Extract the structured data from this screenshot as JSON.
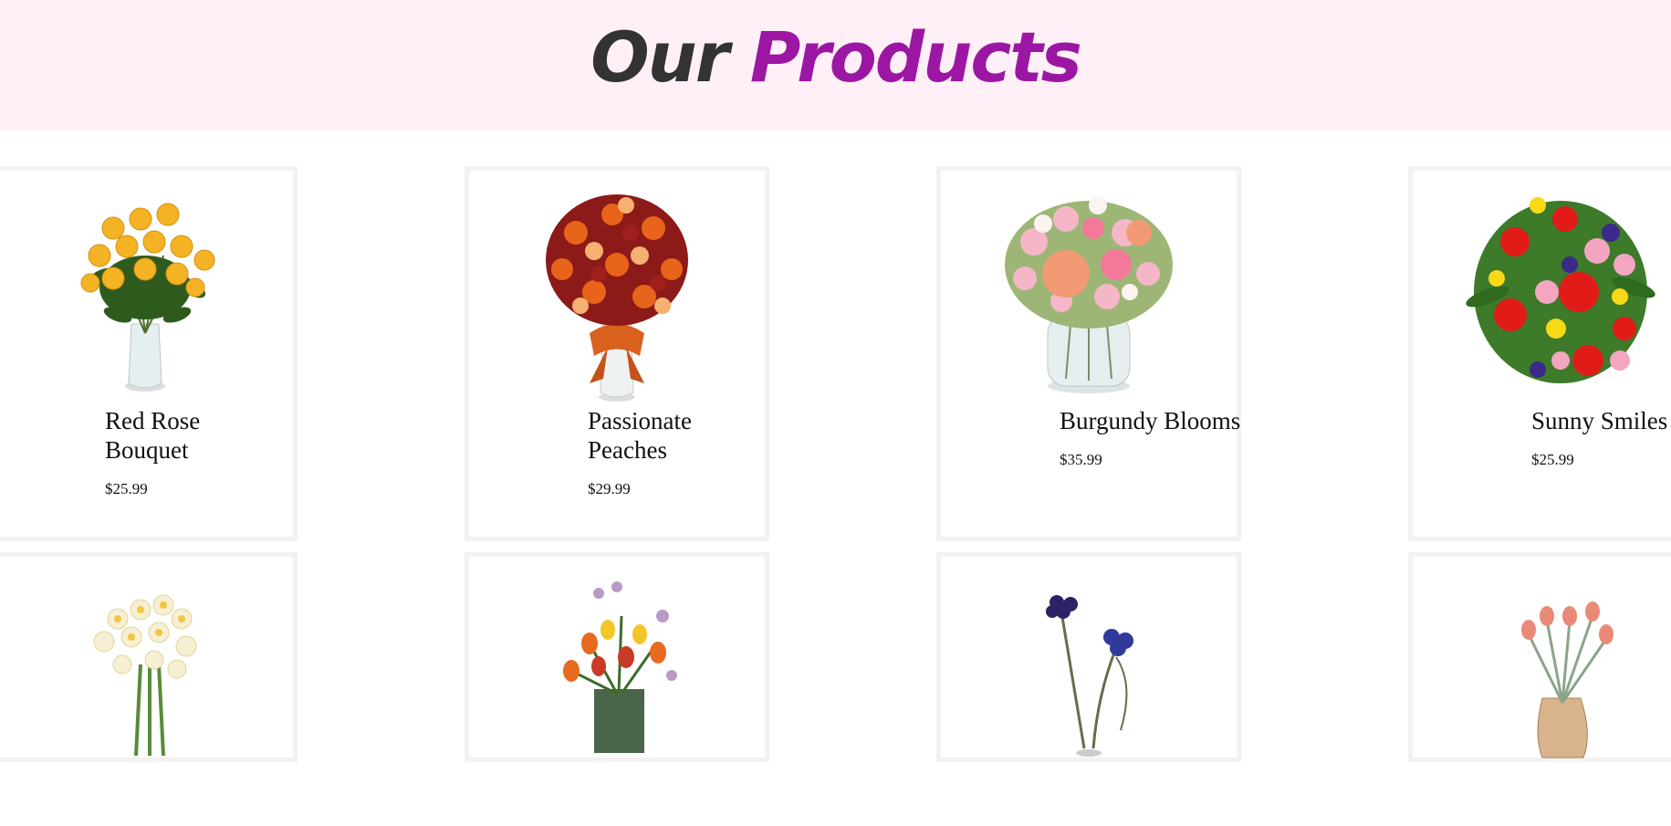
{
  "header": {
    "title_part_1": "Our",
    "title_part_2": "Products"
  },
  "colors": {
    "header_background": "#fff0f8",
    "title_dark": "#333333",
    "title_accent": "#9b17a3",
    "card_border": "#f2f2f2"
  },
  "products": [
    {
      "name": "Red Rose Bouquet",
      "price": "$25.99",
      "image": "yellow-roses-bouquet"
    },
    {
      "name": "Passionate Peaches",
      "price": "$29.99",
      "image": "orange-red-bouquet"
    },
    {
      "name": "Burgundy Blooms",
      "price": "$35.99",
      "image": "pink-peach-bouquet"
    },
    {
      "name": "Sunny Smiles",
      "price": "$25.99",
      "image": "mixed-gerbera-bouquet"
    },
    {
      "name": "",
      "price": "",
      "image": "white-daffodils"
    },
    {
      "name": "",
      "price": "",
      "image": "tulip-vase-bouquet"
    },
    {
      "name": "",
      "price": "",
      "image": "purple-anemone-stems"
    },
    {
      "name": "",
      "price": "",
      "image": "pink-tulips-vase"
    }
  ]
}
